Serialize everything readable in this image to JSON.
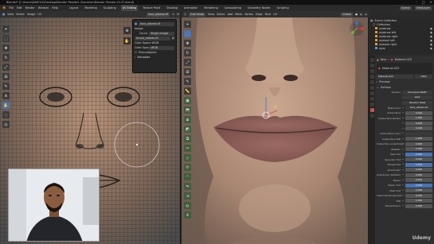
{
  "window": {
    "title": "Blender* [C:\\Users\\DAMOLE\\Desktop\\Blender Realistic Character\\Blender Female-10-37.blend]",
    "controls": [
      "–",
      "□",
      "×"
    ]
  },
  "menubar": {
    "items": [
      "File",
      "Edit",
      "Render",
      "Window",
      "Help"
    ],
    "workspaces": [
      "Layout",
      "Modeling",
      "Sculpting",
      "UV Editing",
      "Texture Paint",
      "Shading",
      "Animation",
      "Rendering",
      "Compositing",
      "Geometry Nodes",
      "Scripting"
    ],
    "active_workspace": "UV Editing",
    "scene": "Scene",
    "view_layer": "ViewLayer"
  },
  "uv_editor": {
    "header_items": [
      "View",
      "Select",
      "Image",
      "UV"
    ],
    "image_name": "face_albedo.tif",
    "toolbar_icons": [
      "cursor-icon",
      "select-box-icon",
      "move-icon",
      "rotate-icon",
      "scale-icon",
      "transform-icon",
      "annotate-icon",
      "rip-icon",
      "grab-icon",
      "relax-icon",
      "pinch-icon"
    ],
    "active_tool_index": 8,
    "popup": {
      "rows": [
        {
          "label": "",
          "value": "face_albedo.tif"
        },
        {
          "label": "",
          "value": "Image"
        },
        {
          "label": "Count",
          "value": "Single Image"
        },
        {
          "label": "",
          "value": "Annot_albedo.tif"
        },
        {
          "label": "",
          "value": "Color Space  sRGB"
        },
        {
          "label": "Color Space",
          "value": "sRGB"
        },
        {
          "label": "",
          "value": "Premultiplied"
        },
        {
          "label": "",
          "value": "Metadata"
        }
      ]
    }
  },
  "viewport": {
    "mode": "Edit Mode",
    "header_items": [
      "View",
      "Select",
      "Add",
      "Mesh",
      "Vertex",
      "Edge",
      "Face",
      "UV"
    ],
    "orientation": "Global",
    "toolbar_icons": [
      "cursor-icon",
      "select-box-icon",
      "move-icon",
      "rotate-icon",
      "scale-icon",
      "transform-icon",
      "annotate-icon",
      "measure-icon",
      "add-cube-icon",
      "extrude-icon",
      "inset-icon",
      "bevel-icon",
      "loop-cut-icon",
      "knife-icon",
      "poly-build-icon",
      "spin-icon",
      "smooth-icon",
      "edge-slide-icon",
      "shrink-icon",
      "shear-icon",
      "rip-icon"
    ],
    "active_tool_index": 1
  },
  "outliner": {
    "header": "Scene Collection",
    "rows": [
      {
        "name": "Collection",
        "type": "collection"
      },
      {
        "name": "eyebrow",
        "type": "object"
      },
      {
        "name": "eyebrow left",
        "type": "object"
      },
      {
        "name": "eyebrow right",
        "type": "object"
      },
      {
        "name": "eyelash left",
        "type": "object"
      },
      {
        "name": "eyelash right",
        "type": "object"
      },
      {
        "name": "eyes",
        "type": "object"
      }
    ]
  },
  "properties": {
    "object": "Face",
    "material": "Material.023",
    "slot_label": "Material.023",
    "link_label": "Data",
    "sections": [
      "Preview",
      "Surface"
    ],
    "surface": "Principled BSDF",
    "distribution": "GGX",
    "subsurface_method": "Random Walk",
    "rows": [
      {
        "label": "Base Color",
        "value": "face_albedo.tif",
        "style": "dark"
      },
      {
        "label": "Subsurface",
        "value": "0.100",
        "style": "normal"
      },
      {
        "label": "Subsurface Radius",
        "value": "1.000",
        "style": "normal"
      },
      {
        "label": "",
        "value": "0.200",
        "style": "normal"
      },
      {
        "label": "",
        "value": "0.100",
        "style": "normal"
      },
      {
        "label": "Subsurface Color",
        "value": "",
        "style": "dark"
      },
      {
        "label": "Subsurface IOR",
        "value": "1.400",
        "style": "normal"
      },
      {
        "label": "Subsurface Anisotropy",
        "value": "0.000",
        "style": "normal"
      },
      {
        "label": "Metallic",
        "value": "0.000",
        "style": "normal"
      },
      {
        "label": "Specular",
        "value": "0.500",
        "style": "blue"
      },
      {
        "label": "Specular Tint",
        "value": "0.000",
        "style": "normal"
      },
      {
        "label": "Roughness",
        "value": "0.500",
        "style": "blue"
      },
      {
        "label": "Anisotropic",
        "value": "0.000",
        "style": "normal"
      },
      {
        "label": "Anisotropic Rotation",
        "value": "0.000",
        "style": "normal"
      },
      {
        "label": "Sheen",
        "value": "0.000",
        "style": "normal"
      },
      {
        "label": "Sheen Tint",
        "value": "0.500",
        "style": "blue"
      },
      {
        "label": "Clearcoat",
        "value": "0.000",
        "style": "normal"
      },
      {
        "label": "Clearcoat Roughness",
        "value": "0.030",
        "style": "normal"
      },
      {
        "label": "IOR",
        "value": "1.450",
        "style": "normal"
      },
      {
        "label": "Transmission",
        "value": "0.000",
        "style": "normal"
      }
    ]
  },
  "watermark": "Udemy"
}
